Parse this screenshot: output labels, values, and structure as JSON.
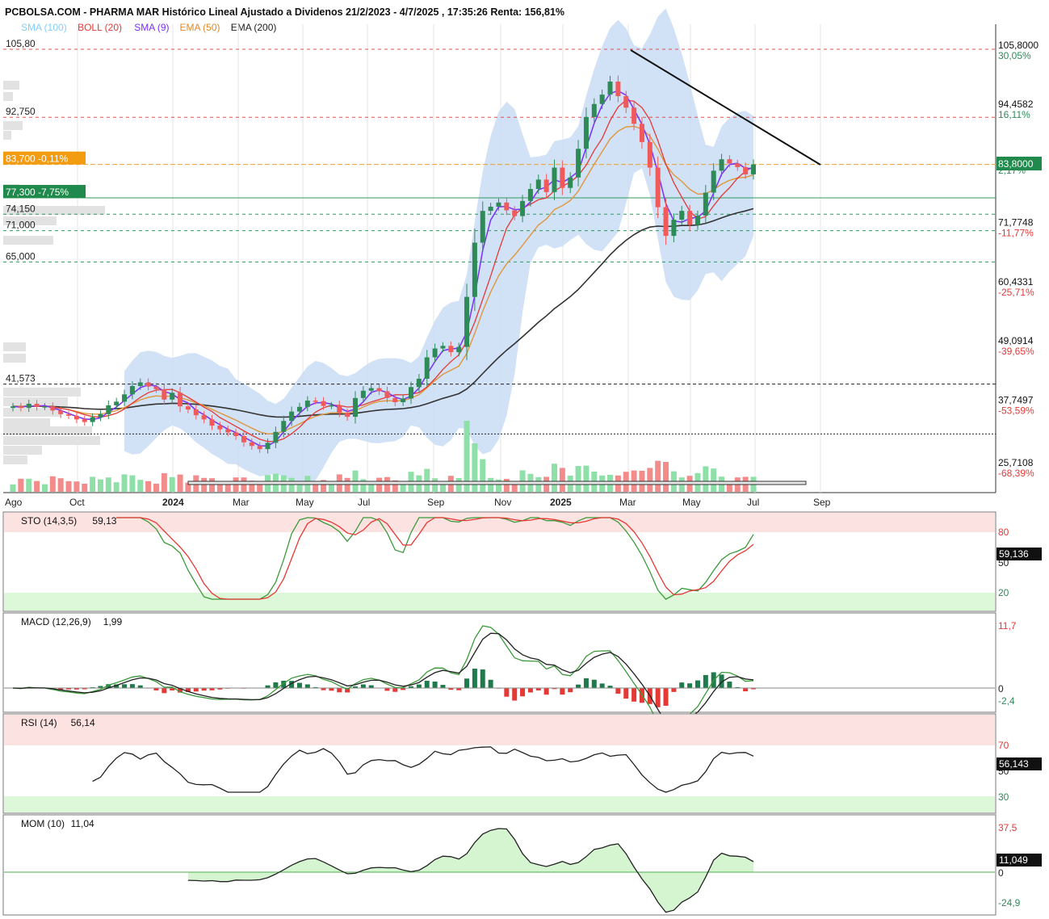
{
  "header": {
    "title": "PCBOLSA.COM - PHARMA MAR Histórico Lineal Ajustado a Dividenos 21/2/2023 - 4/7/2025 , 17:35:26 Renta: 156,81%",
    "indicators": [
      {
        "label": "SMA (100)",
        "color": "#87cefa"
      },
      {
        "label": "BOLL (20)",
        "color": "#e53935"
      },
      {
        "label": "SMA (9)",
        "color": "#7b2ff7"
      },
      {
        "label": "EMA (50)",
        "color": "#e08a2c"
      },
      {
        "label": "EMA (200)",
        "color": "#222222"
      }
    ]
  },
  "colors": {
    "up": "#2e8b57",
    "down": "#f05a5a",
    "boll_band": "#c9dcf5",
    "sma9": "#7b2ff7",
    "boll_mid": "#e53935",
    "ema50": "#e0963c",
    "ema200": "#333333",
    "overbought_zone": "#fde2e2",
    "oversold_zone": "#dcf8d8"
  },
  "price_levels": {
    "left": [
      {
        "text": "105,80",
        "style": "red-dash",
        "value": 105.8
      },
      {
        "text": "92,750",
        "style": "red-dash",
        "value": 92.75
      },
      {
        "text": "83,700 -0,11%",
        "style": "orange-box",
        "value": 83.7
      },
      {
        "text": "77,300 -7,75%",
        "style": "green-box",
        "value": 77.3
      },
      {
        "text": "74,150",
        "style": "green-dash",
        "value": 74.15
      },
      {
        "text": "71,000",
        "style": "green-dash",
        "value": 71.0
      },
      {
        "text": "65,000",
        "style": "green-dash",
        "value": 65.0
      },
      {
        "text": "41,573",
        "style": "black-dash",
        "value": 41.573
      }
    ],
    "right": [
      {
        "price": "105,8000",
        "pct": "30,05%",
        "pct_color": "#2e8b57",
        "value": 105.8
      },
      {
        "price": "94,4582",
        "pct": "16,11%",
        "pct_color": "#2e8b57",
        "value": 94.4582
      },
      {
        "price": "83,8000",
        "pct": "2,17%",
        "pct_color": "#2e8b57",
        "value": 83.8,
        "highlight": true
      },
      {
        "price": "71,7748",
        "pct": "-11,77%",
        "pct_color": "#e53935",
        "value": 71.7748
      },
      {
        "price": "60,4331",
        "pct": "-25,71%",
        "pct_color": "#e53935",
        "value": 60.4331
      },
      {
        "price": "49,0914",
        "pct": "-39,65%",
        "pct_color": "#e53935",
        "value": 49.0914
      },
      {
        "price": "37,7497",
        "pct": "-53,59%",
        "pct_color": "#e53935",
        "value": 37.7497
      },
      {
        "price": "25,7108",
        "pct": "-68,39%",
        "pct_color": "#e53935",
        "value": 25.7108
      }
    ]
  },
  "x_axis": {
    "labels": [
      {
        "text": "Ago",
        "bold": false
      },
      {
        "text": "Oct",
        "bold": false
      },
      {
        "text": "2024",
        "bold": true
      },
      {
        "text": "Mar",
        "bold": false
      },
      {
        "text": "May",
        "bold": false
      },
      {
        "text": "Jul",
        "bold": false
      },
      {
        "text": "Sep",
        "bold": false
      },
      {
        "text": "Nov",
        "bold": false
      },
      {
        "text": "2025",
        "bold": true
      },
      {
        "text": "Mar",
        "bold": false
      },
      {
        "text": "May",
        "bold": false
      },
      {
        "text": "Jul",
        "bold": false
      },
      {
        "text": "Sep",
        "bold": false
      }
    ]
  },
  "panels": {
    "sto": {
      "label": "STO (14,3,5)",
      "value": "59,13",
      "badge": "59,136",
      "levels": [
        "80",
        "50",
        "20"
      ]
    },
    "macd": {
      "label": "MACD (12,26,9)",
      "value": "1,99",
      "levels": [
        "11,7",
        "0",
        "-2,4"
      ]
    },
    "rsi": {
      "label": "RSI (14)",
      "value": "56,14",
      "badge": "56,143",
      "levels": [
        "70",
        "50",
        "30"
      ]
    },
    "mom": {
      "label": "MOM (10)",
      "value": "11,04",
      "badge": "11,049",
      "levels": [
        "37,5",
        "0",
        "-24,9"
      ]
    }
  },
  "chart_data": {
    "type": "candlestick",
    "title": "PCBOLSA.COM - PHARMA MAR Histórico Lineal Ajustado a Dividenos 21/2/2023 - 4/7/2025 , 17:35:26 Renta: 156,81%",
    "ylim": [
      21,
      110
    ],
    "weekly_close": [
      37.3,
      37.0,
      37.8,
      37.2,
      37.3,
      36.5,
      35.8,
      35.5,
      34.8,
      34.3,
      35.2,
      35.8,
      37.5,
      38.2,
      39.6,
      41.2,
      41.9,
      41.1,
      40.6,
      38.6,
      39.9,
      37.3,
      36.7,
      35.6,
      34.8,
      33.6,
      32.9,
      32.3,
      31.6,
      30.4,
      29.7,
      29.1,
      30.3,
      32.4,
      34.5,
      36.3,
      37.2,
      38.4,
      38.3,
      37.4,
      37.5,
      36.1,
      35.3,
      38.9,
      40.3,
      40.8,
      40.2,
      38.9,
      38.1,
      38.8,
      41.0,
      42.6,
      46.7,
      48.4,
      48.9,
      47.7,
      48.7,
      58.3,
      68.7,
      74.8,
      75.6,
      76.4,
      74.9,
      73.8,
      76.7,
      79.0,
      80.8,
      78.4,
      83.1,
      79.2,
      81.2,
      86.7,
      92.8,
      95.3,
      97.1,
      99.6,
      96.8,
      94.6,
      91.5,
      88.0,
      83.1,
      75.5,
      70.0,
      73.1,
      74.8,
      72.1,
      73.9,
      78.3,
      82.5,
      84.7,
      83.9,
      83.2,
      81.8,
      83.7
    ],
    "macd_hist_last": 1.99,
    "sto_k": 59.13,
    "rsi": 56.14,
    "mom": 11.04
  }
}
